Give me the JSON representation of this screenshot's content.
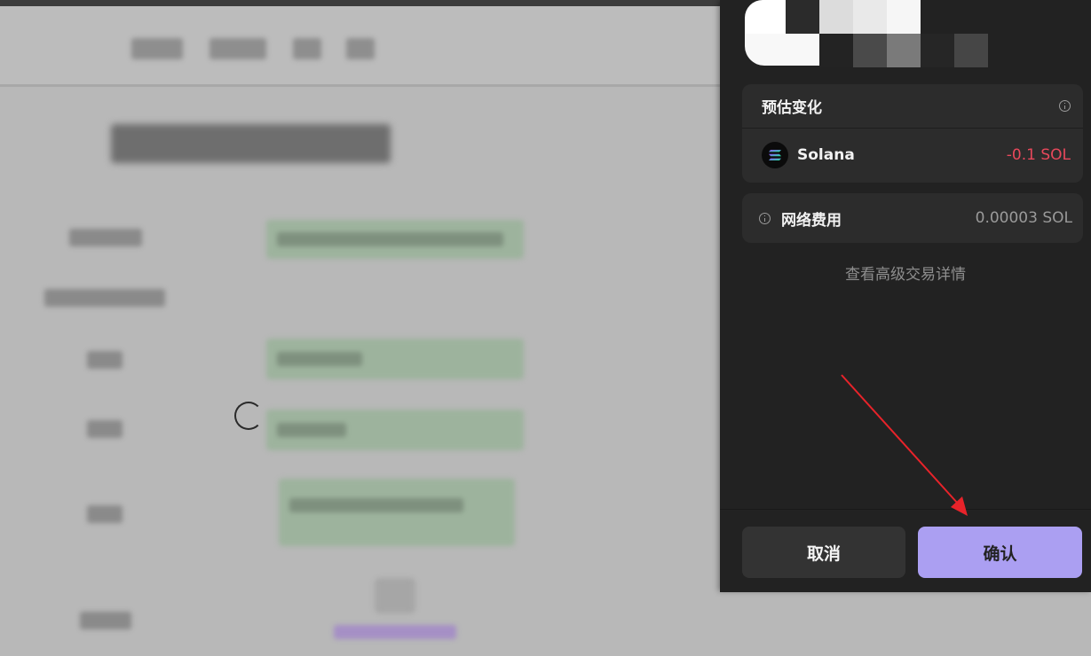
{
  "wallet": {
    "estimated_changes": {
      "title": "预估变化",
      "token_name": "Solana",
      "token_change": "-0.1 SOL"
    },
    "network_fee": {
      "label": "网络费用",
      "value": "0.00003 SOL"
    },
    "advanced_link": "查看高级交易详情",
    "buttons": {
      "cancel": "取消",
      "confirm": "确认"
    }
  },
  "colors": {
    "accent": "#ab9ff2",
    "negative": "#e8485b",
    "panel_bg": "#222222",
    "card_bg": "#2c2c2c"
  },
  "icons": [
    "info-icon",
    "solana-icon",
    "loading-spinner-icon",
    "red-annotation-arrow"
  ]
}
